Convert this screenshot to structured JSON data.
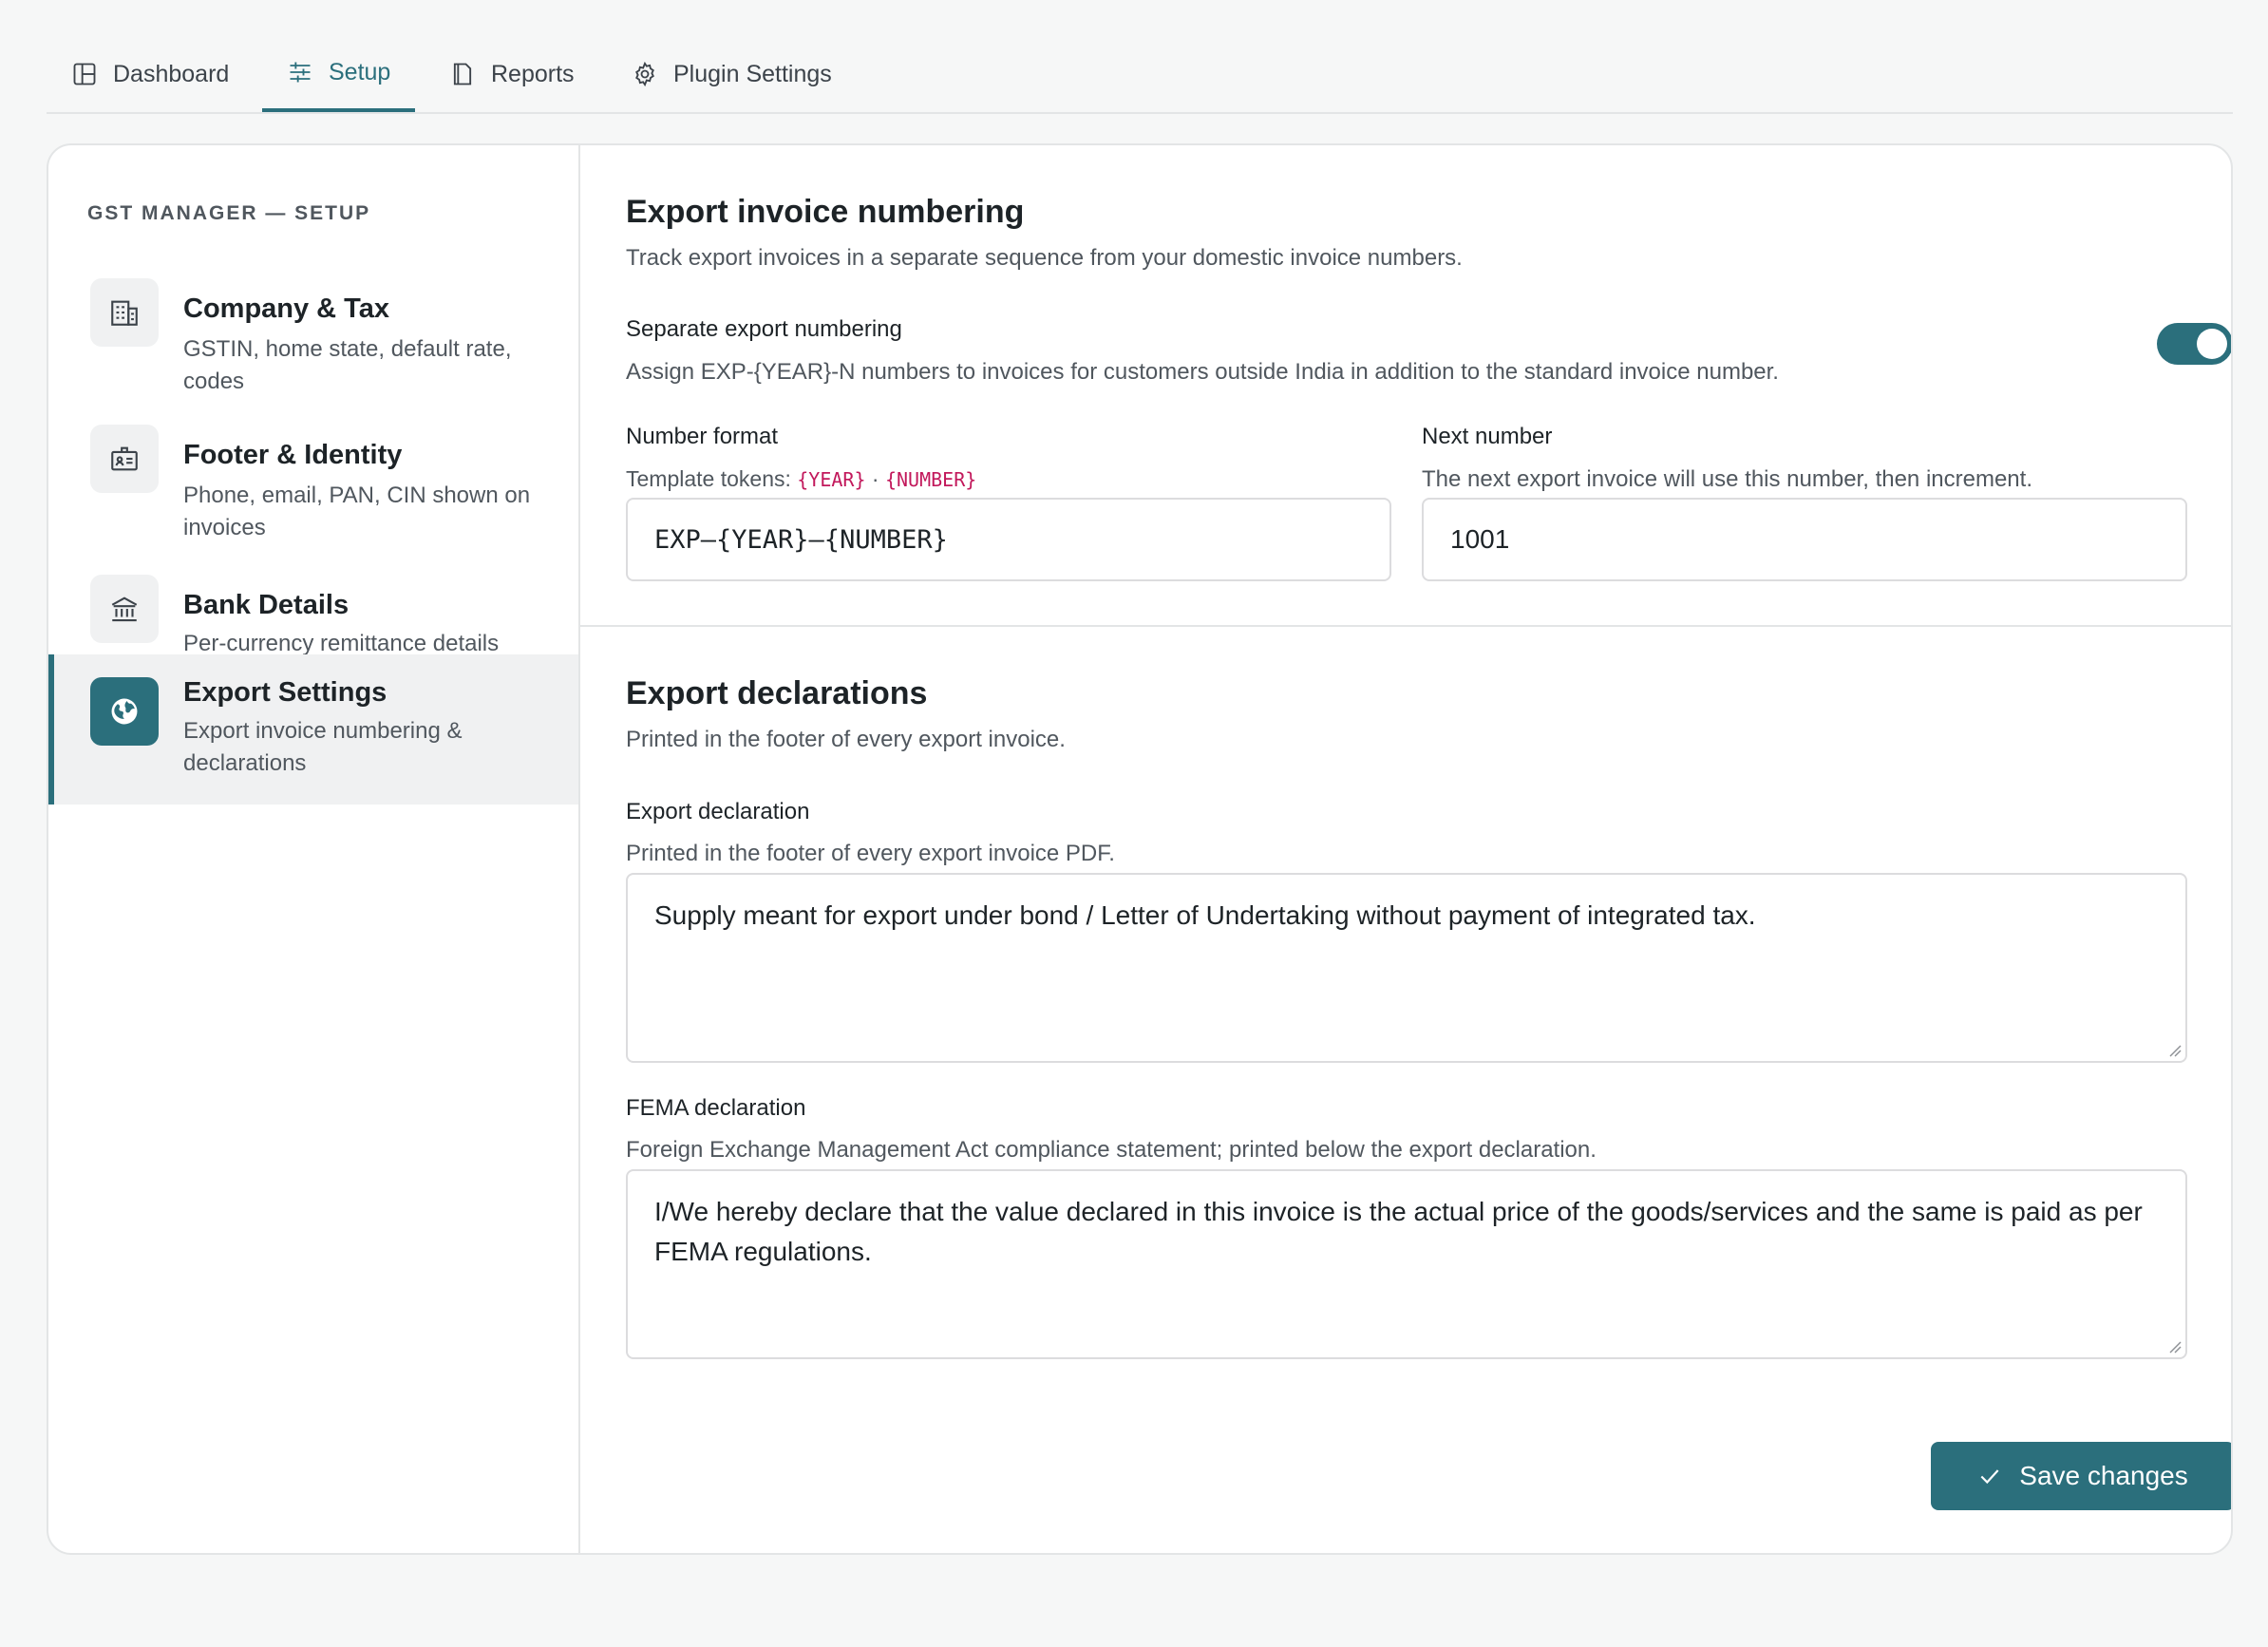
{
  "nav": {
    "tabs": [
      {
        "label": "Dashboard",
        "icon": "dashboard-icon"
      },
      {
        "label": "Setup",
        "icon": "sliders-icon",
        "active": true
      },
      {
        "label": "Reports",
        "icon": "document-icon"
      },
      {
        "label": "Plugin Settings",
        "icon": "gear-icon"
      }
    ]
  },
  "sidebar": {
    "heading": "GST MANAGER — SETUP",
    "items": [
      {
        "title": "Company & Tax",
        "desc": "GSTIN, home state, default rate, codes",
        "icon": "building-icon"
      },
      {
        "title": "Footer & Identity",
        "desc": "Phone, email, PAN, CIN shown on invoices",
        "icon": "id-card-icon"
      },
      {
        "title": "Bank Details",
        "desc": "Per-currency remittance details",
        "icon": "bank-icon"
      },
      {
        "title": "Export Settings",
        "desc": "Export invoice numbering & declarations",
        "icon": "globe-icon",
        "active": true
      }
    ]
  },
  "numbering": {
    "title": "Export invoice numbering",
    "subtitle": "Track export invoices in a separate sequence from your domestic invoice numbers.",
    "toggle_label": "Separate export numbering",
    "toggle_desc": "Assign EXP-{YEAR}-N numbers to invoices for customers outside India in addition to the standard invoice number.",
    "toggle_on": true,
    "format_label": "Number format",
    "format_hint_prefix": "Template tokens:",
    "token_year": "{YEAR}",
    "token_sep": "·",
    "token_number": "{NUMBER}",
    "format_value": "EXP–{YEAR}–{NUMBER}",
    "next_label": "Next number",
    "next_hint": "The next export invoice will use this number, then increment.",
    "next_value": "1001"
  },
  "declarations": {
    "title": "Export declarations",
    "subtitle": "Printed in the footer of every export invoice.",
    "export_label": "Export declaration",
    "export_hint": "Printed in the footer of every export invoice PDF.",
    "export_value": "Supply meant for export under bond / Letter of Undertaking without payment of integrated tax.",
    "fema_label": "FEMA declaration",
    "fema_hint": "Foreign Exchange Management Act compliance statement; printed below the export declaration.",
    "fema_value": "I/We hereby declare that the value declared in this invoice is the actual price of the goods/services and the same is paid as per FEMA regulations."
  },
  "actions": {
    "save_label": "Save changes"
  },
  "colors": {
    "accent": "#2b6f7c",
    "token": "#c2185b"
  }
}
